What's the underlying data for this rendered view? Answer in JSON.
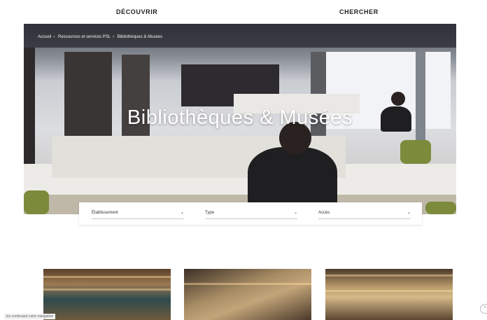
{
  "nav": {
    "discover": "DÉCOUVRIR",
    "search": "CHERCHER"
  },
  "breadcrumb": [
    "Accueil",
    "Ressources et services PSL",
    "Bibliothèques & Musées"
  ],
  "breadcrumb_separator": "›",
  "hero": {
    "title": "Bibliothèques & Musées"
  },
  "filters": [
    {
      "label": "Établissement",
      "icon": "chevron-down-icon"
    },
    {
      "label": "Type",
      "icon": "chevron-down-icon"
    },
    {
      "label": "Accès",
      "icon": "chevron-down-icon"
    }
  ],
  "status_tip": "En continuant votre navigation",
  "colors": {
    "accent_chair": "#7c8a3c",
    "hero_band": "#2f3137"
  }
}
